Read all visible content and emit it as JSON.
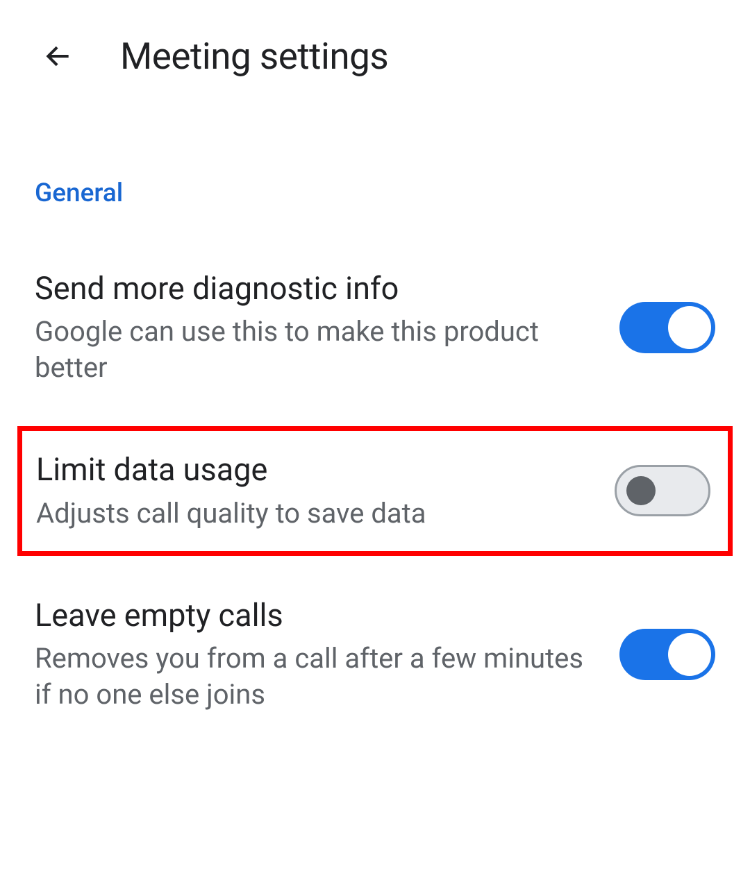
{
  "header": {
    "title": "Meeting settings"
  },
  "section": {
    "label": "General"
  },
  "settings": [
    {
      "title": "Send more diagnostic info",
      "subtitle": "Google can use this to make this product better",
      "enabled": true,
      "highlighted": false
    },
    {
      "title": "Limit data usage",
      "subtitle": "Adjusts call quality to save data",
      "enabled": false,
      "highlighted": true
    },
    {
      "title": "Leave empty calls",
      "subtitle": "Removes you from a call after a few minutes if no one else joins",
      "enabled": true,
      "highlighted": false
    }
  ]
}
